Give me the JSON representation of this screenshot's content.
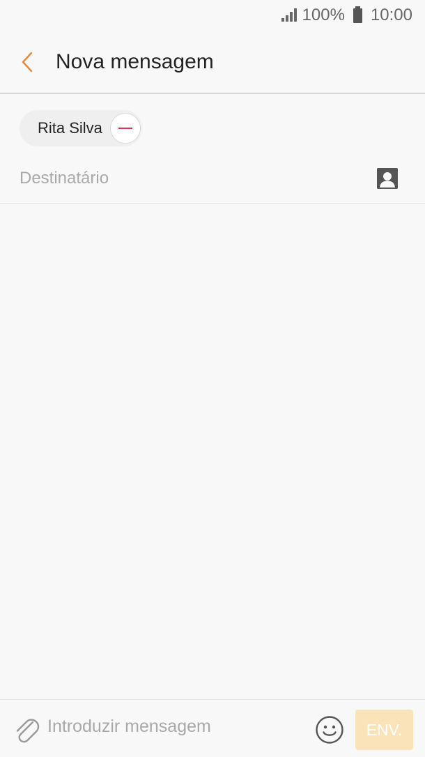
{
  "status_bar": {
    "battery": "100%",
    "time": "10:00"
  },
  "header": {
    "title": "Nova mensagem",
    "back_icon": "chevron-left-icon",
    "accent_color": "#e8883a"
  },
  "recipients": {
    "chips": [
      {
        "name": "Rita Silva"
      }
    ],
    "placeholder": "Destinatário",
    "contacts_icon": "contact-card-icon"
  },
  "composer": {
    "attach_icon": "paperclip-icon",
    "placeholder": "Introduzir mensagem",
    "emoji_icon": "smiley-icon",
    "send_label": "ENV.",
    "send_color": "#fbe3b9"
  }
}
